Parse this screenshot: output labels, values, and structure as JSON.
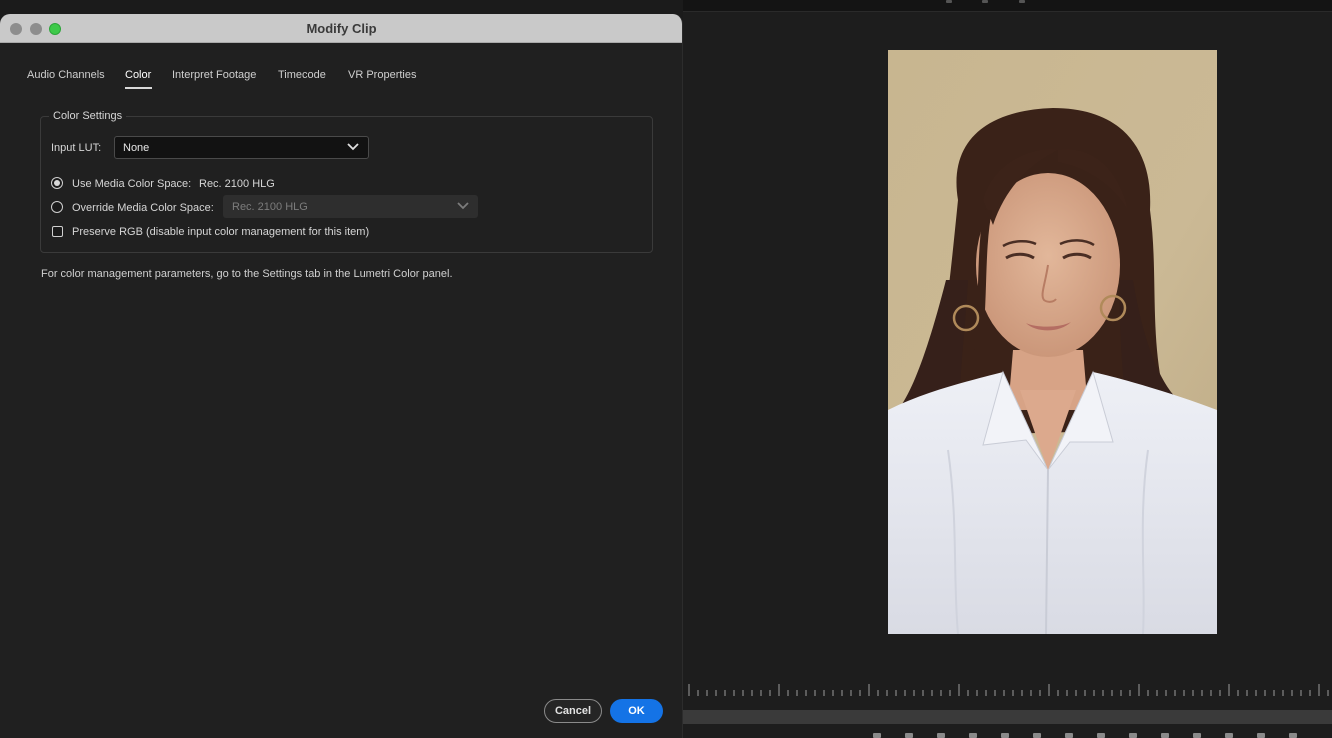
{
  "dialog": {
    "title": "Modify Clip",
    "tabs": [
      {
        "label": "Audio Channels"
      },
      {
        "label": "Color"
      },
      {
        "label": "Interpret Footage"
      },
      {
        "label": "Timecode"
      },
      {
        "label": "VR Properties"
      }
    ],
    "active_tab": "Color",
    "color_settings": {
      "group_title": "Color Settings",
      "input_lut_label": "Input LUT:",
      "input_lut_value": "None",
      "use_media_label": "Use Media Color Space:",
      "use_media_value": "Rec. 2100 HLG",
      "use_media_selected": true,
      "override_label": "Override Media Color Space:",
      "override_value": "Rec. 2100 HLG",
      "override_selected": false,
      "preserve_rgb_label": "Preserve RGB (disable input color management for this item)",
      "preserve_rgb_checked": false
    },
    "note": "For color management parameters, go to the Settings tab in the Lumetri Color panel.",
    "buttons": {
      "cancel": "Cancel",
      "ok": "OK"
    }
  },
  "colors": {
    "accent": "#1473e6",
    "window_bg": "#202020",
    "titlebar": "#c9c9c9",
    "maximize_green": "#3ec94a"
  },
  "icons": {
    "lut_dropdown": "chevron-down-icon",
    "override_dropdown": "chevron-down-icon"
  }
}
